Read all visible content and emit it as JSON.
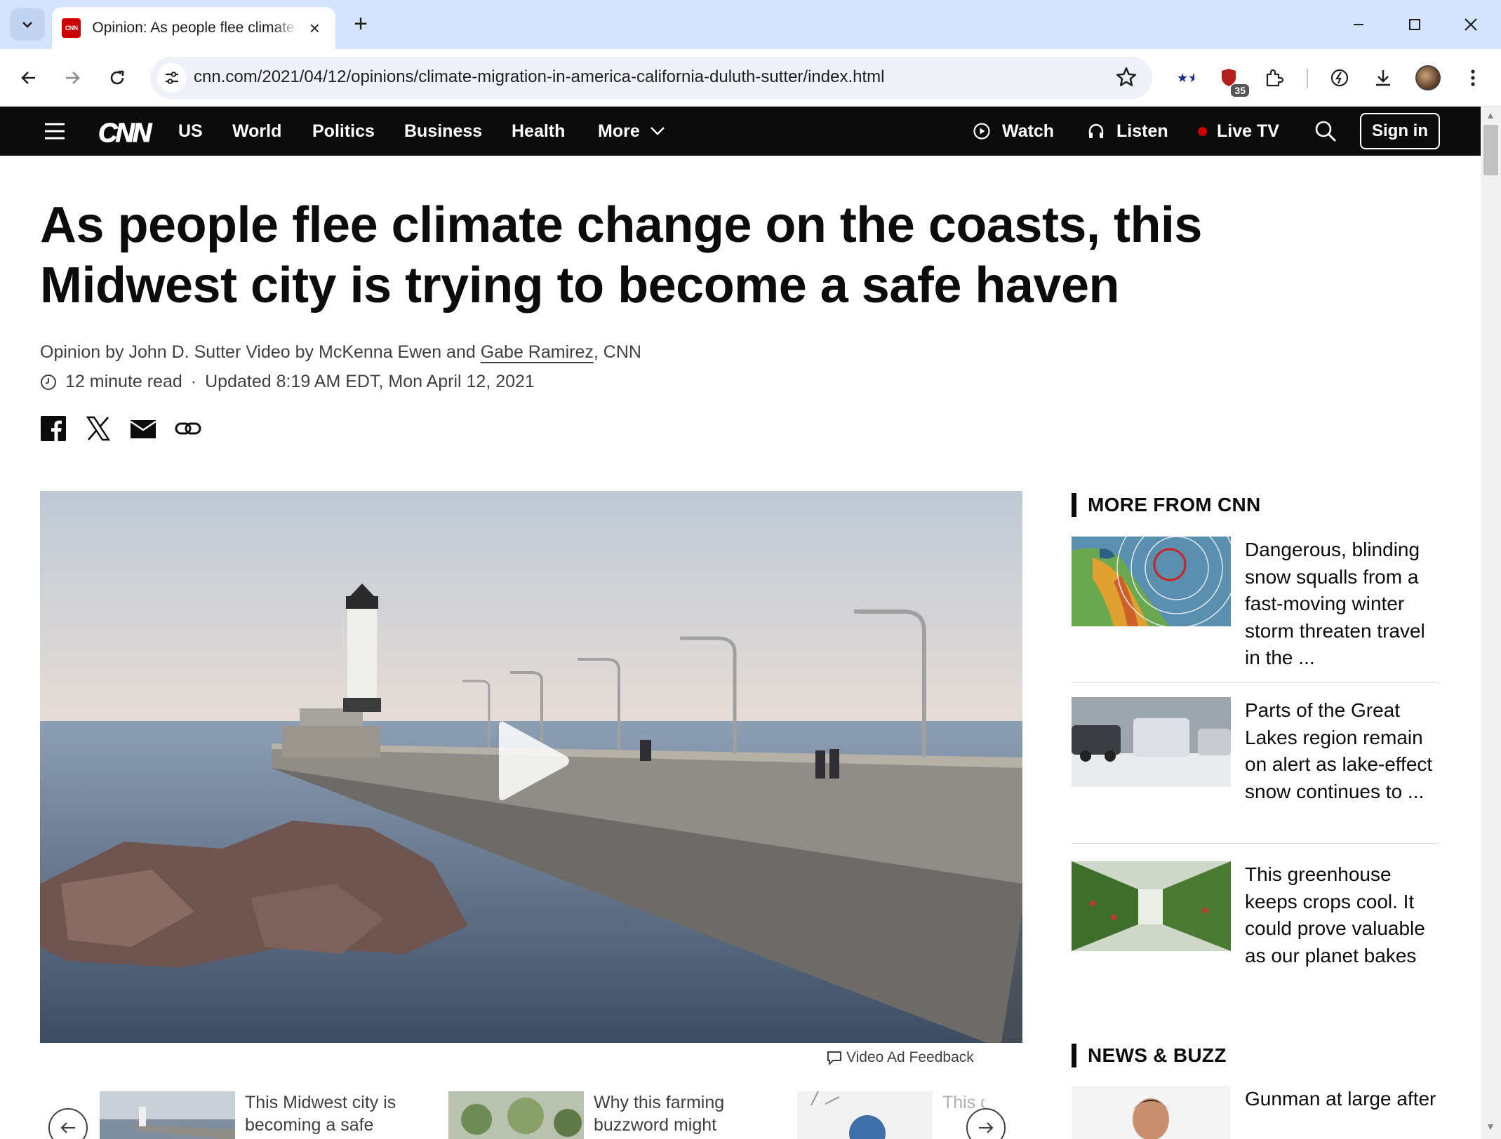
{
  "browser": {
    "tab_title": "Opinion: As people flee climate change on the coasts, this Midwest city is trying to become a safe haven",
    "tab_favicon_text": "CNN",
    "url": "cnn.com/2021/04/12/opinions/climate-migration-in-america-california-duluth-sutter/index.html",
    "extension_badge": "35"
  },
  "nav": {
    "logo": "CNN",
    "items": [
      "US",
      "World",
      "Politics",
      "Business",
      "Health",
      "More"
    ],
    "watch": "Watch",
    "listen": "Listen",
    "live_tv": "Live TV",
    "sign_in": "Sign in",
    "live_dot_color": "#cc0000"
  },
  "article": {
    "headline": "As people flee climate change on the coasts, this Midwest city is trying to become a safe haven",
    "byline_prefix": "Opinion by John D. Sutter Video by McKenna Ewen and ",
    "byline_link": "Gabe Ramirez",
    "byline_suffix": ", CNN",
    "read_time": "12 minute read",
    "separator": "·",
    "updated": "Updated 8:19 AM EDT, Mon April 12, 2021",
    "video_feedback": "Video Ad Feedback"
  },
  "carousel": [
    {
      "text": "This Midwest city is becoming a safe"
    },
    {
      "text": "Why this farming buzzword might"
    },
    {
      "text": "This c… sim…"
    }
  ],
  "sidebar": {
    "more_heading": "MORE FROM CNN",
    "more_items": [
      {
        "text": "Dangerous, blinding snow squalls from a fast-moving winter storm threaten travel in the ..."
      },
      {
        "text": "Parts of the Great Lakes region remain on alert as lake-effect snow continues to ..."
      },
      {
        "text": "This greenhouse keeps crops cool. It could prove valuable as our planet bakes"
      }
    ],
    "buzz_heading": "NEWS & BUZZ",
    "buzz_items": [
      {
        "text": "Gunman at large after"
      }
    ]
  }
}
